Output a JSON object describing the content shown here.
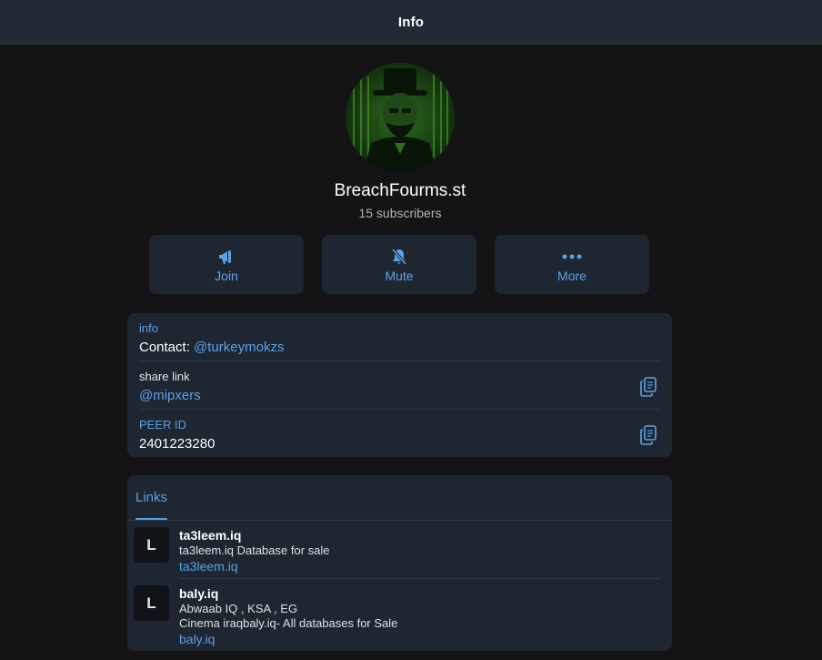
{
  "header": {
    "title": "Info"
  },
  "profile": {
    "name": "BreachFourms.st",
    "subscribers": "15 subscribers"
  },
  "actions": [
    {
      "label": "Join",
      "icon": "megaphone-icon"
    },
    {
      "label": "Mute",
      "icon": "bell-slash-icon"
    },
    {
      "label": "More",
      "icon": "more-dots-icon"
    }
  ],
  "info": {
    "section_label": "info",
    "contact_prefix": "Contact: ",
    "contact_handle": "@turkeymokzs",
    "share_label": "share link",
    "share_value": "@mipxers",
    "peer_label": "PEER ID",
    "peer_value": "2401223280"
  },
  "links": {
    "tab_label": "Links",
    "items": [
      {
        "thumb": "L",
        "title": "ta3leem.iq",
        "desc_lines": [
          "ta3leem.iq Database for sale"
        ],
        "url": "ta3leem.iq"
      },
      {
        "thumb": "L",
        "title": "baly.iq",
        "desc_lines": [
          "Abwaab IQ , KSA , EG",
          "Cinema iraqbaly.iq- All databases for Sale"
        ],
        "url": "baly.iq"
      }
    ]
  },
  "colors": {
    "background": "#141414",
    "card": "#1e2631",
    "accent": "#5aa2e8",
    "header": "#222b35"
  }
}
